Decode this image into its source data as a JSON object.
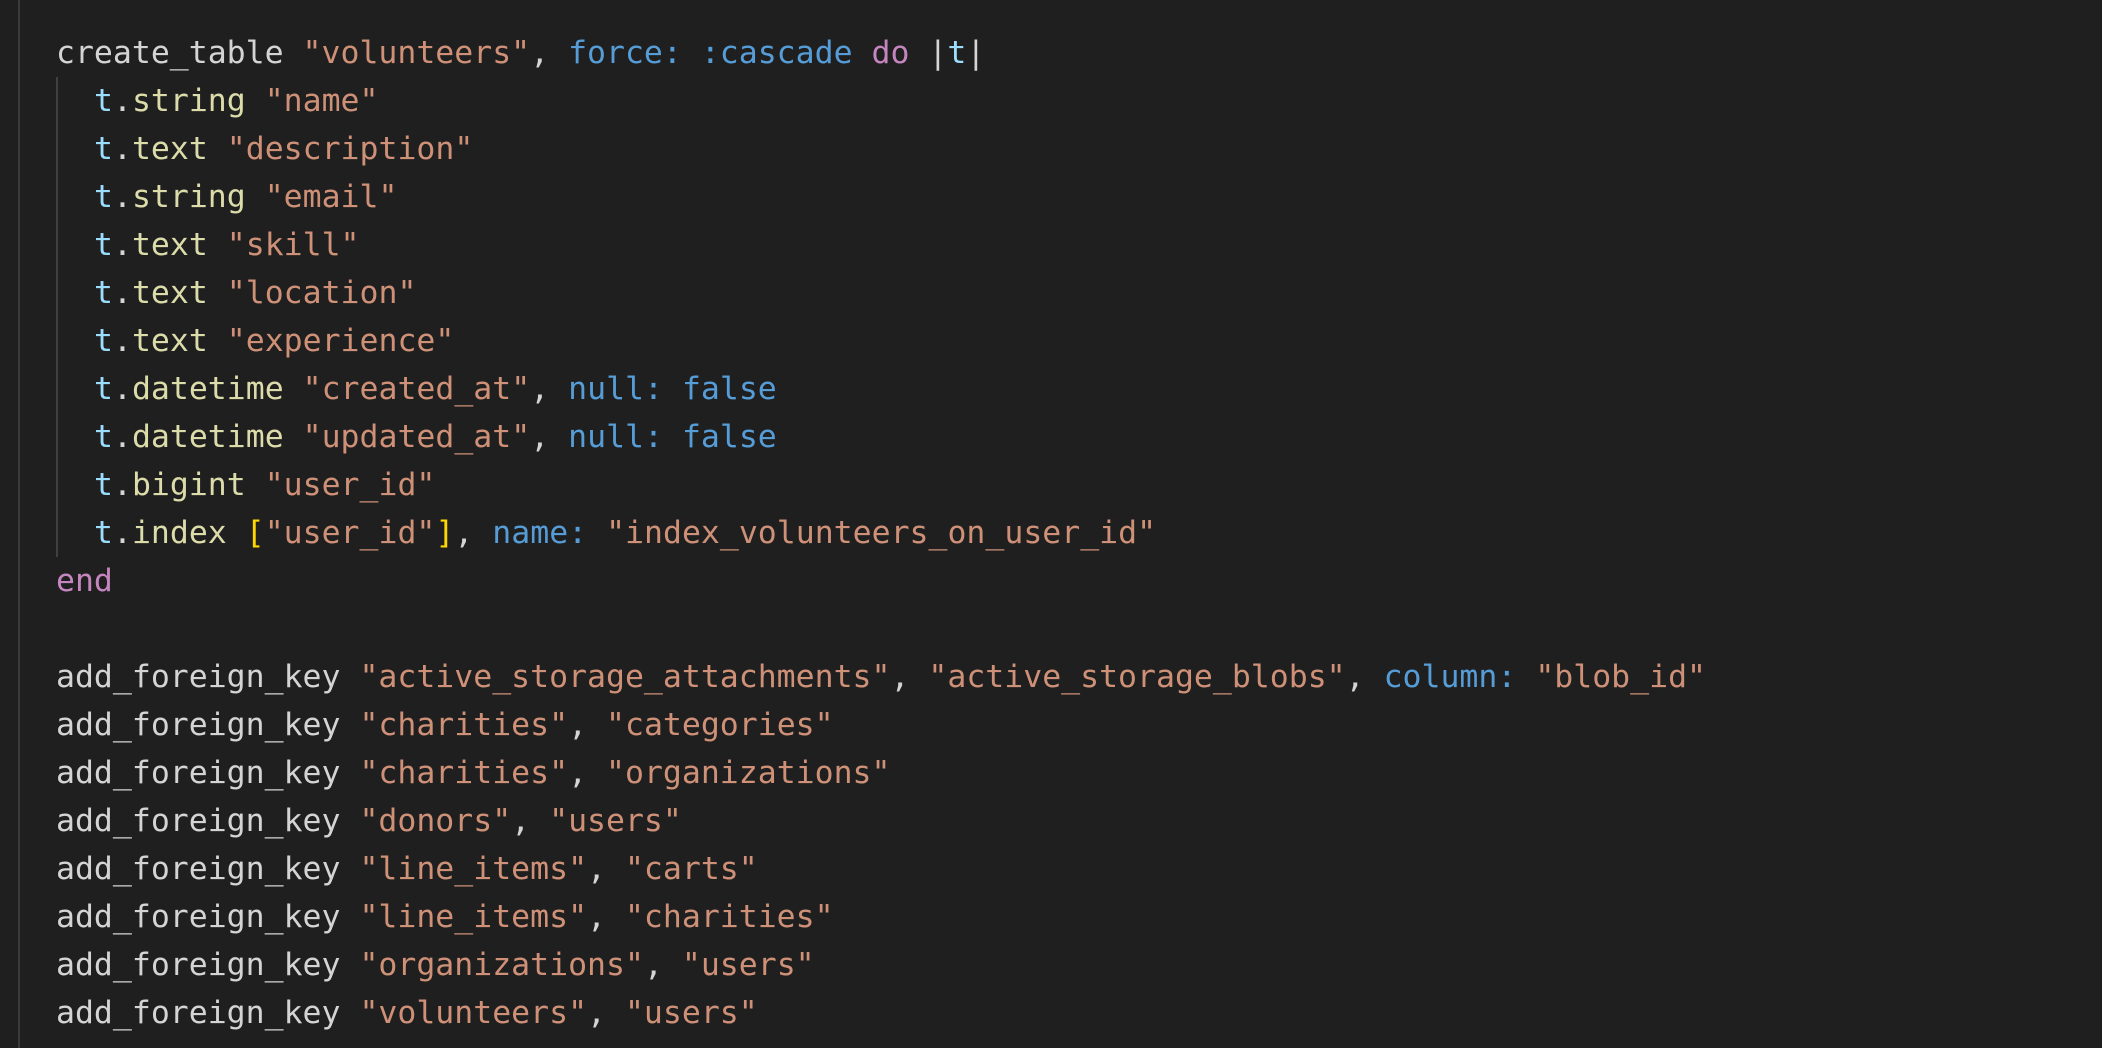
{
  "create_table": {
    "method": "create_table",
    "table_name": "\"volunteers\"",
    "comma": ",",
    "option_key": "force:",
    "option_value": ":cascade",
    "do_keyword": "do",
    "block_open": "|",
    "block_var": "t",
    "block_close": "|",
    "columns": [
      {
        "var": "t",
        "dot": ".",
        "type": "string",
        "name": "\"name\""
      },
      {
        "var": "t",
        "dot": ".",
        "type": "text",
        "name": "\"description\""
      },
      {
        "var": "t",
        "dot": ".",
        "type": "string",
        "name": "\"email\""
      },
      {
        "var": "t",
        "dot": ".",
        "type": "text",
        "name": "\"skill\""
      },
      {
        "var": "t",
        "dot": ".",
        "type": "text",
        "name": "\"location\""
      },
      {
        "var": "t",
        "dot": ".",
        "type": "text",
        "name": "\"experience\""
      },
      {
        "var": "t",
        "dot": ".",
        "type": "datetime",
        "name": "\"created_at\"",
        "comma": ",",
        "opt_key": "null:",
        "opt_val": "false"
      },
      {
        "var": "t",
        "dot": ".",
        "type": "datetime",
        "name": "\"updated_at\"",
        "comma": ",",
        "opt_key": "null:",
        "opt_val": "false"
      },
      {
        "var": "t",
        "dot": ".",
        "type": "bigint",
        "name": "\"user_id\""
      }
    ],
    "index_line": {
      "var": "t",
      "dot": ".",
      "method": "index",
      "bracket_open": "[",
      "arg": "\"user_id\"",
      "bracket_close": "]",
      "comma": ",",
      "opt_key": "name:",
      "opt_val": "\"index_volunteers_on_user_id\""
    },
    "end_keyword": "end"
  },
  "foreign_keys": [
    {
      "method": "add_foreign_key",
      "from": "\"active_storage_attachments\"",
      "to": "\"active_storage_blobs\"",
      "opt_key": "column:",
      "opt_val": "\"blob_id\""
    },
    {
      "method": "add_foreign_key",
      "from": "\"charities\"",
      "to": "\"categories\""
    },
    {
      "method": "add_foreign_key",
      "from": "\"charities\"",
      "to": "\"organizations\""
    },
    {
      "method": "add_foreign_key",
      "from": "\"donors\"",
      "to": "\"users\""
    },
    {
      "method": "add_foreign_key",
      "from": "\"line_items\"",
      "to": "\"carts\""
    },
    {
      "method": "add_foreign_key",
      "from": "\"line_items\"",
      "to": "\"charities\""
    },
    {
      "method": "add_foreign_key",
      "from": "\"organizations\"",
      "to": "\"users\""
    },
    {
      "method": "add_foreign_key",
      "from": "\"volunteers\"",
      "to": "\"users\""
    }
  ],
  "colors": {
    "background": "#1f1f1f",
    "default": "#d4d4d4",
    "string": "#ce9178",
    "keyword": "#c586c0",
    "symbol": "#569cd6",
    "variable": "#9cdcfe",
    "method": "#dcdcaa",
    "bracket": "#ffd700"
  }
}
